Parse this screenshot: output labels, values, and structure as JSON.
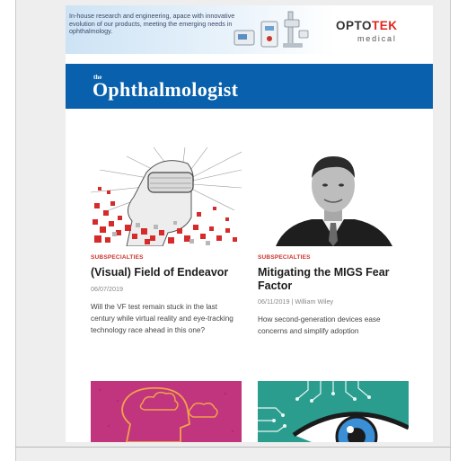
{
  "ad": {
    "text": "In-house research and engineering, apace with innovative evolution of our products, meeting the emerging needs in ophthalmology.",
    "logo_part1": "OPTO",
    "logo_part2": "TEK",
    "logo_sub": "medical",
    "accent_color": "#e2261c"
  },
  "masthead": {
    "the": "the",
    "title": "Ophthalmologist",
    "color": "#0960ad"
  },
  "articles": [
    {
      "category": "SUBSPECIALTIES",
      "headline": "(Visual) Field of Endeavor",
      "date": "06/07/2019",
      "author": "",
      "summary": "Will the VF test remain stuck in the last century while virtual reality and eye-tracking technology race ahead in this one?",
      "image_icon": "vr-headset-illustration-icon"
    },
    {
      "category": "SUBSPECIALTIES",
      "headline": "Mitigating the MIGS Fear Factor",
      "date": "06/11/2019",
      "author": "William Wiley",
      "summary": "How second-generation devices ease concerns and simplify adoption",
      "image_icon": "portrait-photo-icon"
    },
    {
      "image_icon": "head-clouds-illustration-icon"
    },
    {
      "image_icon": "eye-circuit-illustration-icon"
    }
  ],
  "colors": {
    "category": "#c9302c",
    "headline": "#1d1d1d",
    "meta": "#888888"
  }
}
